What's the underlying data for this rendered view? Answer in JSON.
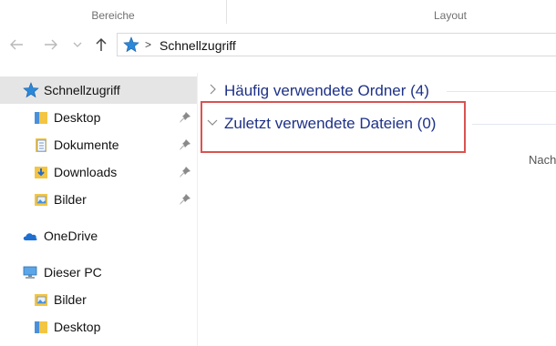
{
  "ribbon": {
    "groups": [
      {
        "label": "Bereiche"
      },
      {
        "label": "Layout"
      }
    ]
  },
  "navbar": {
    "back_icon": "arrow-left-icon",
    "forward_icon": "arrow-right-icon",
    "recent_icon": "chevron-down-icon",
    "up_icon": "arrow-up-icon",
    "address": {
      "location_icon": "quick-access-star-icon",
      "separator": ">",
      "crumb": "Schnellzugriff"
    }
  },
  "sidebar": {
    "items": [
      {
        "label": "Schnellzugriff",
        "icon": "quick-access-star-icon",
        "selected": true,
        "pinned": false
      },
      {
        "label": "Desktop",
        "icon": "folder-icon",
        "pinned": true
      },
      {
        "label": "Dokumente",
        "icon": "documents-icon",
        "pinned": true
      },
      {
        "label": "Downloads",
        "icon": "downloads-icon",
        "pinned": true
      },
      {
        "label": "Bilder",
        "icon": "pictures-icon",
        "pinned": true
      },
      {
        "label": "OneDrive",
        "icon": "cloud-icon",
        "pinned": false
      },
      {
        "label": "Dieser PC",
        "icon": "computer-icon",
        "pinned": false
      },
      {
        "label": "Bilder",
        "icon": "pictures-icon",
        "pinned": false
      },
      {
        "label": "Desktop",
        "icon": "folder-icon",
        "pinned": false
      }
    ]
  },
  "content": {
    "groups": [
      {
        "title": "Häufig verwendete Ordner (4)",
        "expanded": false
      },
      {
        "title": "Zuletzt verwendete Dateien (0)",
        "expanded": true
      }
    ],
    "truncated_text": "Nach"
  },
  "colors": {
    "accent_text": "#1e3287",
    "selection_bg": "#e5e5e5",
    "highlight_border": "#d9534f",
    "folder_yellow": "#f4c542",
    "star_blue": "#2b88d8"
  }
}
